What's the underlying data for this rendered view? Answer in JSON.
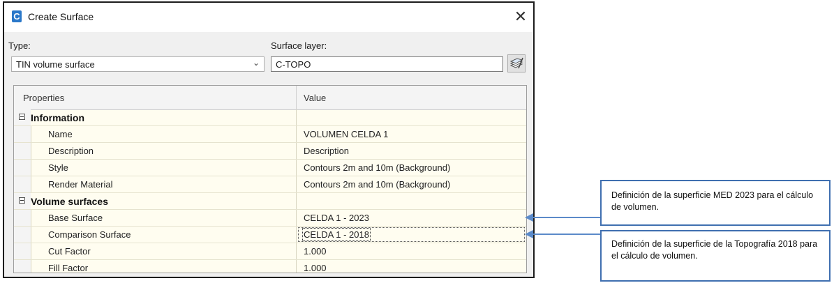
{
  "window": {
    "title": "Create Surface",
    "close_glyph": "✕",
    "icon": "civil3d-app-icon"
  },
  "type": {
    "label": "Type:",
    "value": "TIN volume surface"
  },
  "surface_layer": {
    "label": "Surface layer:",
    "value": "C-TOPO"
  },
  "grid": {
    "header": {
      "properties": "Properties",
      "value": "Value"
    },
    "information": {
      "label": "Information",
      "rows": [
        {
          "name": "Name",
          "value": "VOLUMEN CELDA 1"
        },
        {
          "name": "Description",
          "value": "Description"
        },
        {
          "name": "Style",
          "value": "Contours 2m and 10m (Background)"
        },
        {
          "name": "Render Material",
          "value": "Contours 2m and 10m (Background)"
        }
      ]
    },
    "volume_surfaces": {
      "label": "Volume surfaces",
      "rows": [
        {
          "name": "Base Surface",
          "value": "CELDA 1 - 2023"
        },
        {
          "name": "Comparison Surface",
          "value": "CELDA 1 - 2018"
        },
        {
          "name": "Cut Factor",
          "value": "1.000"
        },
        {
          "name": "Fill Factor",
          "value": "1.000"
        }
      ]
    }
  },
  "annotations": {
    "base": "Definición de la superficie MED 2023 para el cálculo de volumen.",
    "comparison": "Definición de la superficie de la Topografía 2018 para el cálculo de volumen."
  },
  "colors": {
    "accent": "#3f6fb0",
    "grid_bg": "#fffdf0"
  }
}
